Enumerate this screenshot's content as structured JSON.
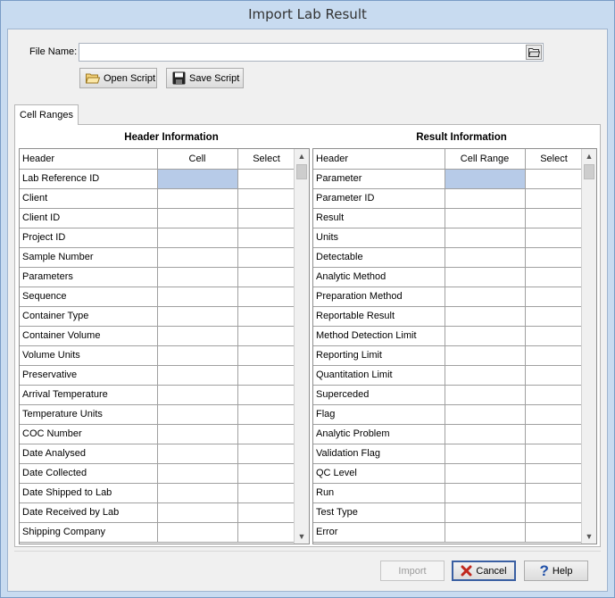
{
  "window": {
    "title": "Import Lab Result"
  },
  "file": {
    "label": "File Name:",
    "value": "",
    "placeholder": ""
  },
  "toolbar": {
    "open_script": "Open Script",
    "save_script": "Save Script"
  },
  "tabs": [
    {
      "label": "Cell Ranges",
      "selected": true
    }
  ],
  "header_info": {
    "title": "Header Information",
    "columns": [
      "Header",
      "Cell",
      "Select"
    ],
    "rows": [
      "Lab Reference ID",
      "Client",
      "Client ID",
      "Project ID",
      "Sample Number",
      "Parameters",
      "Sequence",
      "Container Type",
      "Container Volume",
      "Volume Units",
      "Preservative",
      "Arrival Temperature",
      "Temperature Units",
      "COC Number",
      "Date Analysed",
      "Date Collected",
      "Date Shipped to Lab",
      "Date Received by Lab",
      "Shipping Company"
    ]
  },
  "result_info": {
    "title": "Result Information",
    "columns": [
      "Header",
      "Cell Range",
      "Select"
    ],
    "rows": [
      "Parameter",
      "Parameter ID",
      "Result",
      "Units",
      "Detectable",
      "Analytic Method",
      "Preparation Method",
      "Reportable Result",
      "Method Detection Limit",
      "Reporting Limit",
      "Quantitation Limit",
      "Superceded",
      "Flag",
      "Analytic Problem",
      "Validation Flag",
      "QC Level",
      "Run",
      "Test Type",
      "Error"
    ]
  },
  "buttons": {
    "import": "Import",
    "cancel": "Cancel",
    "help": "Help"
  },
  "colors": {
    "selected_cell": "#b7cbe8",
    "window_frame": "#c8dbf0",
    "cancel_x": "#c0281e",
    "help_q": "#2050a8"
  }
}
